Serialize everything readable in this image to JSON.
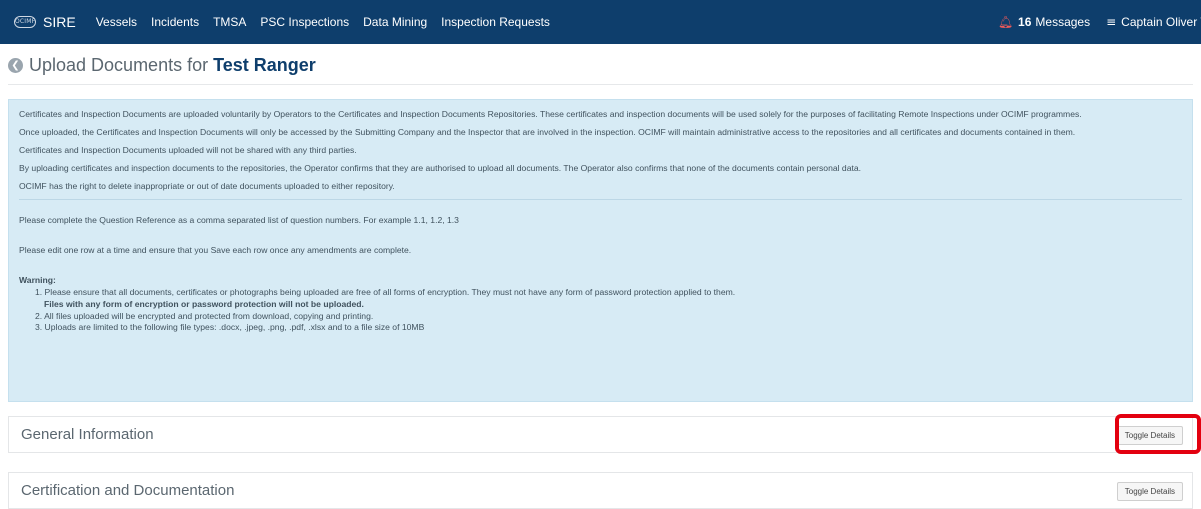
{
  "nav": {
    "logo_text": "OCIMF",
    "brand": "SIRE",
    "links": [
      "Vessels",
      "Incidents",
      "TMSA",
      "PSC Inspections",
      "Data Mining",
      "Inspection Requests"
    ],
    "message_count": "16",
    "messages_label": "Messages",
    "user": "Captain Oliver Te"
  },
  "page": {
    "title_prefix": "Upload Documents for",
    "vessel_name": "Test Ranger"
  },
  "info": {
    "paragraphs": [
      "Certificates and Inspection Documents are uploaded voluntarily by Operators to the Certificates and Inspection Documents Repositories. These certificates and inspection documents will be used solely for the purposes of facilitating Remote Inspections under OCIMF programmes.",
      "Once uploaded, the Certificates and Inspection Documents will only be accessed by the Submitting Company and the Inspector that are involved in the inspection. OCIMF will maintain administrative access to the repositories and all certificates and documents contained in them.",
      "Certificates and Inspection Documents uploaded will not be shared with any third parties.",
      "By uploading certificates and inspection documents to the repositories, the Operator confirms that they are authorised to upload all documents. The Operator also confirms that none of the documents contain personal data.",
      "OCIMF has the right to delete inappropriate or out of date documents uploaded to either repository."
    ],
    "question_ref_note": "Please complete the Question Reference as a comma separated list of question numbers. For example 1.1, 1.2, 1.3",
    "edit_note": "Please edit one row at a time and ensure that you Save each row once any amendments are complete.",
    "warning_title": "Warning:",
    "warnings": [
      "1. Please ensure that all documents, certificates or photographs being uploaded are free of all forms of encryption. They must not have any form of password protection applied to them.",
      "Files with any form of encryption or password protection will not be uploaded.",
      "2. All files uploaded will be encrypted and protected from download, copying and printing.",
      "3. Uploads are limited to the following file types: .docx, .jpeg, .png, .pdf, .xlsx and to a file size of 10MB"
    ]
  },
  "sections": [
    {
      "title": "General Information",
      "button": "Toggle Details"
    },
    {
      "title": "Certification and Documentation",
      "button": "Toggle Details"
    }
  ],
  "colors": {
    "navbar": "#0e3e6c",
    "info_bg": "#d7ebf5",
    "highlight": "#e3000f",
    "bell": "#ef5a5a"
  },
  "icons": {
    "logo": "ocimf-logo-icon",
    "bell": "bell-icon",
    "menu": "hamburger-menu-icon",
    "back": "back-arrow-icon"
  }
}
